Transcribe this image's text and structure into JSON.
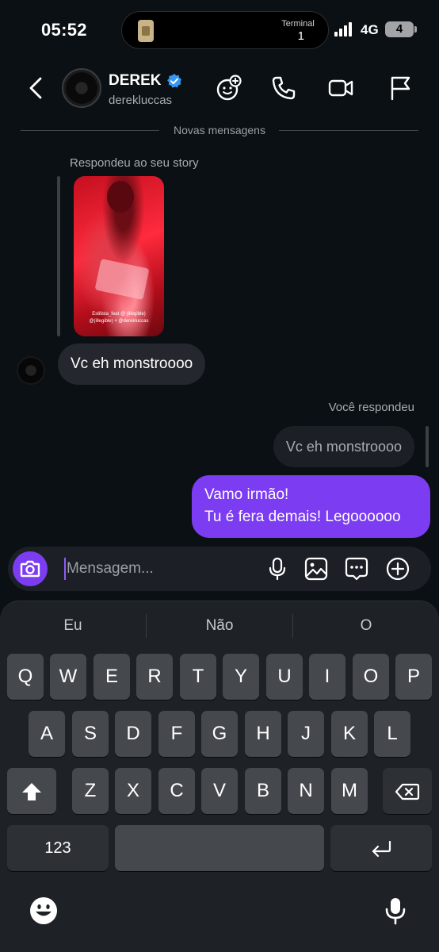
{
  "status_bar": {
    "time": "05:52",
    "live_activity_label": "Terminal",
    "live_activity_value": "1",
    "network": "4G",
    "battery": "4"
  },
  "header": {
    "name": "DEREK",
    "handle": "derekluccas",
    "verified": true,
    "icons": [
      "back-icon",
      "effects-icon",
      "phone-icon",
      "video-icon",
      "flag-icon"
    ]
  },
  "thread": {
    "divider_label": "Novas mensagens",
    "story_reply_caption": "Respondeu ao seu story",
    "story_credit_line1": "Estilista_feat @ (illegible)",
    "story_credit_line2": "@(illegible) + @derekluccas",
    "incoming_message": "Vc eh monstroooo",
    "you_replied_label": "Você respondeu",
    "quoted_message": "Vc eh monstroooo",
    "outgoing_line1": "Vamo irmão!",
    "outgoing_line2": "Tu é fera demais! Legoooooo"
  },
  "composer": {
    "placeholder": "Mensagem...",
    "icons": [
      "camera-icon",
      "microphone-icon",
      "gallery-icon",
      "sticker-icon",
      "add-icon"
    ]
  },
  "keyboard": {
    "suggestions": [
      "Eu",
      "Não",
      "O"
    ],
    "row1": [
      "Q",
      "W",
      "E",
      "R",
      "T",
      "Y",
      "U",
      "I",
      "O",
      "P"
    ],
    "row2": [
      "A",
      "S",
      "D",
      "F",
      "G",
      "H",
      "J",
      "K",
      "L"
    ],
    "row3": [
      "Z",
      "X",
      "C",
      "V",
      "B",
      "N",
      "M"
    ],
    "numbers_label": "123",
    "icons": [
      "shift-icon",
      "backspace-icon",
      "return-icon",
      "emoji-icon",
      "dictation-icon"
    ]
  },
  "colors": {
    "accent": "#7b3cf2",
    "background": "#0b1014",
    "bubble_incoming": "#24282e",
    "verified": "#3897f0"
  }
}
